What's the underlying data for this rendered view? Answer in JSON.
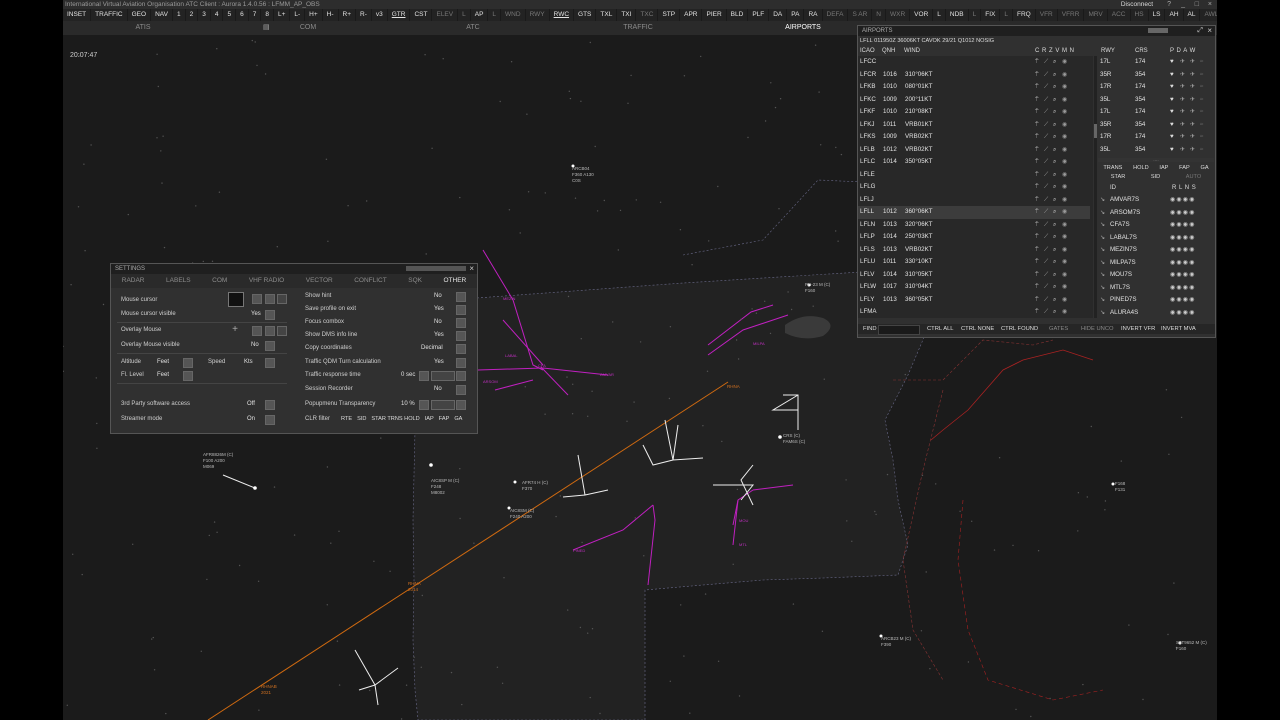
{
  "titlebar": {
    "title": "International Virtual Aviation Organisation  ATC Client : Aurora 1.4.0.56 : LFMM_AP_OBS",
    "disconnect_label": "Disconnect",
    "window_buttons": [
      "?",
      "_",
      "□",
      "×"
    ]
  },
  "menubar": {
    "items": [
      "INSET",
      "TRAFFIC",
      "GEO",
      "NAV",
      "1",
      "2",
      "3",
      "4",
      "5",
      "6",
      "7",
      "8",
      "L+",
      "L-",
      "H+",
      "H-",
      "R+",
      "R-",
      "v3",
      "GTR",
      "CST",
      "ELEV",
      "L",
      "AP",
      "L",
      "WND",
      "RWY",
      "RWC",
      "GTS",
      "TXL",
      "TXI",
      "TXC",
      "STP",
      "APR",
      "PIER",
      "BLD",
      "PLF",
      "DA",
      "PA",
      "RA",
      "DEFA",
      "S AR",
      "N",
      "WXR",
      "VOR",
      "L",
      "NDB",
      "L",
      "FIX",
      "L",
      "FRQ",
      "VFR",
      "VFRR",
      "MRV",
      "ACC",
      "HS",
      "LS",
      "AH",
      "AL",
      "AWL",
      "ATC",
      "RR",
      "T",
      "MA",
      "CLR",
      "VERA",
      "N"
    ]
  },
  "tabs": [
    "ATIS",
    "COM",
    "ATC",
    "TRAFFIC",
    "AIRPORTS"
  ],
  "active_tab": "AIRPORTS",
  "clock": "20:07:47",
  "settings": {
    "title": "SETTINGS",
    "tabs": [
      "RADAR",
      "LABELS",
      "COM",
      "VHF RADIO",
      "VECTOR",
      "CONFLICT",
      "SQK",
      "OTHER"
    ],
    "active_tab": "OTHER",
    "left": {
      "mouse_cursor": "Mouse cursor",
      "mouse_cursor_visible": "Mouse cursor visible",
      "mouse_cursor_visible_val": "Yes",
      "overlay_mouse": "Overlay Mouse",
      "overlay_mouse_visible": "Overlay Mouse visible",
      "overlay_mouse_visible_val": "No",
      "altitude": "Altitude",
      "altitude_val": "Feet",
      "speed": "Speed",
      "speed_val": "Kts",
      "fl_level": "Fl. Level",
      "fl_level_val": "Feet",
      "third_party": "3rd Party software access",
      "third_party_val": "Off",
      "streamer": "Streamer mode",
      "streamer_val": "On"
    },
    "right": {
      "show_hint": "Show hint",
      "show_hint_val": "No",
      "save_profile": "Save profile on exit",
      "save_profile_val": "Yes",
      "focus_combox": "Focus combox",
      "focus_combox_val": "No",
      "show_dms": "Show DMS info line",
      "show_dms_val": "Yes",
      "copy_coords": "Copy coordinates",
      "copy_coords_val": "Decimal",
      "traffic_qdm": "Traffic QDM Turn calculation",
      "traffic_qdm_val": "Yes",
      "traffic_resp": "Traffic response time",
      "traffic_resp_val": "0 sec",
      "session_rec": "Session Recorder",
      "session_rec_val": "No",
      "popup_transp": "Popupmenu Transparency",
      "popup_transp_val": "10 %",
      "clr_filter": "CLR filter",
      "clr_filter_opts": [
        "RTE",
        "SID",
        "STAR TRNS HOLD",
        "IAP",
        "FAP",
        "GA"
      ]
    }
  },
  "airports": {
    "title": "AIRPORTS",
    "metar": "LFLL 011950Z 36006KT CAVOK 29/21 Q1012 NOSIG",
    "headers": {
      "icao": "ICAO",
      "qnh": "QNH",
      "wind": "WIND",
      "flags": "C R Z V M N"
    },
    "rows": [
      {
        "icao": "LFCC",
        "qnh": "",
        "wind": ""
      },
      {
        "icao": "LFCR",
        "qnh": "1016",
        "wind": "310°06KT"
      },
      {
        "icao": "LFKB",
        "qnh": "1010",
        "wind": "080°01KT"
      },
      {
        "icao": "LFKC",
        "qnh": "1009",
        "wind": "200°11KT"
      },
      {
        "icao": "LFKF",
        "qnh": "1010",
        "wind": "210°08KT"
      },
      {
        "icao": "LFKJ",
        "qnh": "1011",
        "wind": "VRB01KT"
      },
      {
        "icao": "LFKS",
        "qnh": "1009",
        "wind": "VRB02KT"
      },
      {
        "icao": "LFLB",
        "qnh": "1012",
        "wind": "VRB02KT"
      },
      {
        "icao": "LFLC",
        "qnh": "1014",
        "wind": "350°05KT"
      },
      {
        "icao": "LFLE",
        "qnh": "",
        "wind": ""
      },
      {
        "icao": "LFLG",
        "qnh": "",
        "wind": ""
      },
      {
        "icao": "LFLJ",
        "qnh": "",
        "wind": ""
      },
      {
        "icao": "LFLL",
        "qnh": "1012",
        "wind": "360°06KT"
      },
      {
        "icao": "LFLN",
        "qnh": "1013",
        "wind": "320°06KT"
      },
      {
        "icao": "LFLP",
        "qnh": "1014",
        "wind": "250°03KT"
      },
      {
        "icao": "LFLS",
        "qnh": "1013",
        "wind": "VRB02KT"
      },
      {
        "icao": "LFLU",
        "qnh": "1011",
        "wind": "330°10KT"
      },
      {
        "icao": "LFLV",
        "qnh": "1014",
        "wind": "310°05KT"
      },
      {
        "icao": "LFLW",
        "qnh": "1017",
        "wind": "310°04KT"
      },
      {
        "icao": "LFLY",
        "qnh": "1013",
        "wind": "360°05KT"
      },
      {
        "icao": "LFMA",
        "qnh": "",
        "wind": ""
      }
    ],
    "runway_headers": {
      "rwy": "RWY",
      "crs": "CRS",
      "flags": "P D A W"
    },
    "runways": [
      {
        "rwy": "17L",
        "crs": "174"
      },
      {
        "rwy": "35R",
        "crs": "354"
      },
      {
        "rwy": "17R",
        "crs": "174"
      },
      {
        "rwy": "35L",
        "crs": "354"
      },
      {
        "rwy": "17L",
        "crs": "174"
      },
      {
        "rwy": "35R",
        "crs": "354"
      },
      {
        "rwy": "17R",
        "crs": "174"
      },
      {
        "rwy": "35L",
        "crs": "354"
      }
    ],
    "proc_tabs": [
      "TRANS",
      "HOLD",
      "IAP",
      "FAP",
      "GA"
    ],
    "proc_tabs2": [
      "STAR",
      "SID",
      "AUTO"
    ],
    "proc_headers": {
      "id": "ID",
      "flags": "R L N S"
    },
    "procedures": [
      "AMVAR7S",
      "ARSOM7S",
      "CFA7S",
      "LABAL7S",
      "MEZIN7S",
      "MILPA7S",
      "MOU7S",
      "MTL7S",
      "PINED7S",
      "ALURA4S"
    ],
    "bottom_buttons": [
      "FIND",
      "CTRL ALL",
      "CTRL NONE",
      "CTRL FOUND",
      "GATES",
      "HIDE UNCO",
      "INVERT VFR",
      "INVERT MVA"
    ]
  },
  "map_labels": [
    {
      "id": "ac1",
      "text": "AFR8826M (C)\nF100 A200\nM069"
    },
    {
      "id": "ac2",
      "text": "AFR74 H (C)\nF370"
    },
    {
      "id": "ac3",
      "text": "AIC8SM (C)\nF240 A200"
    },
    {
      "id": "ac4",
      "text": "AFR8154\nF160 A200"
    },
    {
      "id": "ac5",
      "text": "CRS (C)\nFAM6S (C)"
    },
    {
      "id": "ac6",
      "text": "AIC8SP M (C)\nF248\nM8002"
    },
    {
      "id": "ac7",
      "text": "PH-23 M (C)\nF160"
    },
    {
      "id": "ac8",
      "text": "ARCB23 M (C)\nF390"
    },
    {
      "id": "ac9",
      "text": "S8T9652 M (C)\nF160"
    },
    {
      "id": "ac10",
      "text": "F168\nF131"
    },
    {
      "id": "ac11",
      "text": "RHNA\n2014"
    },
    {
      "id": "ac12",
      "text": "RHNAB\n2021"
    },
    {
      "id": "ac13",
      "text": "ARCB04\nF360 A130\nC0S"
    }
  ]
}
